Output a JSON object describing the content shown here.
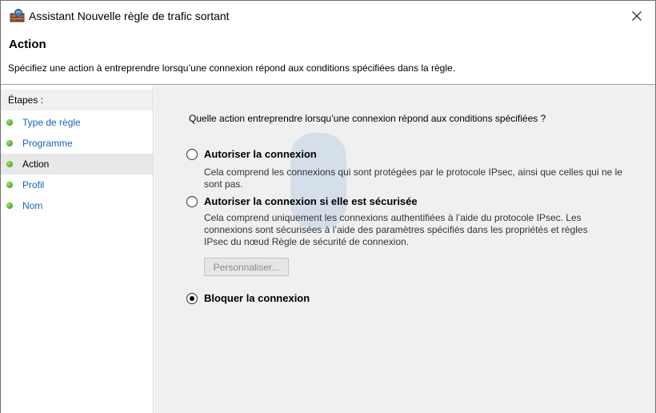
{
  "window": {
    "title": "Assistant Nouvelle règle de trafic sortant",
    "app_icon": "firewall-icon",
    "close_icon": "close-icon"
  },
  "header": {
    "title": "Action",
    "description": "Spécifiez une action à entreprendre lorsqu’une connexion répond aux conditions spécifiées dans la règle."
  },
  "sidebar": {
    "steps_label": "Étapes :",
    "items": [
      {
        "label": "Type de règle",
        "active": false
      },
      {
        "label": "Programme",
        "active": false
      },
      {
        "label": "Action",
        "active": true
      },
      {
        "label": "Profil",
        "active": false
      },
      {
        "label": "Nom",
        "active": false
      }
    ]
  },
  "main": {
    "question": "Quelle action entreprendre lorsqu’une connexion répond aux conditions spécifiées ?",
    "options": [
      {
        "label": "Autoriser la connexion",
        "desc": "Cela comprend les connexions qui sont protégées par le protocole IPsec, ainsi que celles qui ne le sont pas.",
        "selected": false
      },
      {
        "label": "Autoriser la connexion si elle est sécurisée",
        "desc": "Cela comprend uniquement les connexions authentifiées à l’aide du protocole IPsec. Les connexions sont sécurisées à l’aide des paramètres spécifiés dans les propriétés et règles IPsec du nœud Règle de sécurité de connexion.",
        "selected": false
      },
      {
        "label": "Bloquer la connexion",
        "desc": "",
        "selected": true
      }
    ],
    "customize_button": "Personnaliser..."
  },
  "colors": {
    "link": "#1565c0",
    "content_bg": "#f0f0f0",
    "step_dot": "#5cb82e"
  }
}
